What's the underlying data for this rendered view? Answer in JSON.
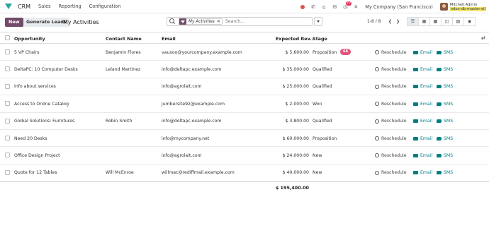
{
  "topbar": {
    "app_name": "CRM",
    "menus": [
      "Sales",
      "Reporting",
      "Configuration"
    ],
    "company": "My Company (San Francisco)",
    "user_name": "Mitchell Admin",
    "user_db": "odoo-db-master-all",
    "activity_badge": "20"
  },
  "control": {
    "new_label": "New",
    "generate_label": "Generate Leads",
    "title": "My Activities",
    "facet_label": "My Activities",
    "search_placeholder": "Search...",
    "pager": "1-8 / 8"
  },
  "table": {
    "headers": {
      "opportunity": "Opportunity",
      "contact": "Contact Name",
      "email": "Email",
      "revenue": "Expected Rev...",
      "stage": "Stage"
    },
    "rows": [
      {
        "opportunity": "5 VP Chairs",
        "contact": "Benjamin Flores",
        "email": "vauxoo@yourcompany.example.com",
        "revenue": "$ 5,600.00",
        "stage": "Proposition",
        "tag": "68"
      },
      {
        "opportunity": "DeltaPC: 10 Computer Desks",
        "contact": "Leland Martinez",
        "email": "info@deltapc.example.com",
        "revenue": "$ 35,000.00",
        "stage": "Qualified"
      },
      {
        "opportunity": "Info about services",
        "contact": "",
        "email": "info@agrolait.com",
        "revenue": "$ 25,000.00",
        "stage": "Qualified"
      },
      {
        "opportunity": "Access to Online Catalog",
        "contact": "",
        "email": "jumbersite92@example.com",
        "revenue": "$ 2,000.00",
        "stage": "Won"
      },
      {
        "opportunity": "Global Solutions: Furnitures",
        "contact": "Robin Smith",
        "email": "info@deltapc.example.com",
        "revenue": "$ 3,800.00",
        "stage": "Qualified"
      },
      {
        "opportunity": "Need 20 Desks",
        "contact": "",
        "email": "info@mycompany.net",
        "revenue": "$ 60,000.00",
        "stage": "Proposition"
      },
      {
        "opportunity": "Office Design Project",
        "contact": "",
        "email": "info@agrolait.com",
        "revenue": "$ 24,000.00",
        "stage": "New"
      },
      {
        "opportunity": "Quote for 12 Tables",
        "contact": "Will McEnroe",
        "email": "willmac@rediffmail.example.com",
        "revenue": "$ 40,000.00",
        "stage": "New"
      }
    ],
    "actions": {
      "reschedule": "Reschedule",
      "email": "Email",
      "sms": "SMS"
    },
    "total": "$ 195,400.00"
  }
}
